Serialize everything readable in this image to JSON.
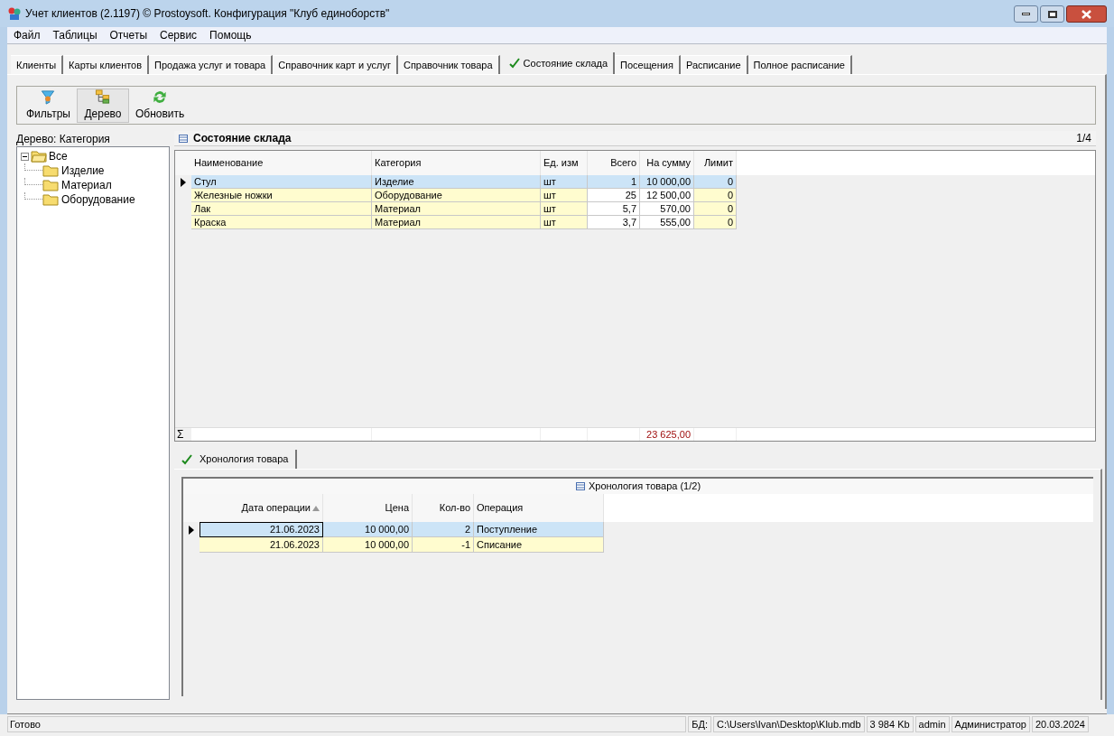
{
  "window": {
    "title": "Учет клиентов (2.1197) © Prostoysoft. Конфигурация \"Клуб единоборств\""
  },
  "menu": [
    "Файл",
    "Таблицы",
    "Отчеты",
    "Сервис",
    "Помощь"
  ],
  "tabs": [
    {
      "label": "Клиенты",
      "selected": false
    },
    {
      "label": "Карты клиентов",
      "selected": false
    },
    {
      "label": "Продажа услуг и товара",
      "selected": false
    },
    {
      "label": "Справочник карт и услуг",
      "selected": false
    },
    {
      "label": "Справочник товара",
      "selected": false
    },
    {
      "label": "Состояние склада",
      "selected": true
    },
    {
      "label": "Посещения",
      "selected": false
    },
    {
      "label": "Расписание",
      "selected": false
    },
    {
      "label": "Полное расписание",
      "selected": false
    }
  ],
  "toolbar": [
    {
      "kind": "filter",
      "label": "Фильтры",
      "selected": false
    },
    {
      "kind": "tree",
      "label": "Дерево",
      "selected": true
    },
    {
      "kind": "refresh",
      "label": "Обновить",
      "selected": false
    }
  ],
  "tree": {
    "title": "Дерево: Категория",
    "items": [
      {
        "label": "Все",
        "expanded": true,
        "children": [
          {
            "label": "Изделие"
          },
          {
            "label": "Материал"
          },
          {
            "label": "Оборудование"
          }
        ]
      }
    ]
  },
  "grid": {
    "title": "Состояние склада",
    "counter": "1/4",
    "total_symbol": "Σ",
    "columns": [
      {
        "label": "Наименование",
        "kind": "text"
      },
      {
        "label": "Категория",
        "kind": "text"
      },
      {
        "label": "Ед. изм",
        "kind": "text"
      },
      {
        "label": "Всего",
        "kind": "computed"
      },
      {
        "label": "На сумму",
        "kind": "computed",
        "total": "23 625,00"
      },
      {
        "label": "Лимит",
        "kind": "number"
      }
    ],
    "rows": [
      {
        "selected": true,
        "cells": [
          "Стул",
          "Изделие",
          "шт",
          "1",
          "10 000,00",
          "0"
        ]
      },
      {
        "selected": false,
        "cells": [
          "Железные ножки",
          "Оборудование",
          "шт",
          "25",
          "12 500,00",
          "0"
        ]
      },
      {
        "selected": false,
        "cells": [
          "Лак",
          "Материал",
          "шт",
          "5,7",
          "570,00",
          "0"
        ]
      },
      {
        "selected": false,
        "cells": [
          "Краска",
          "Материал",
          "шт",
          "3,7",
          "555,00",
          "0"
        ]
      }
    ]
  },
  "detail_tab": {
    "label": "Хронология товара",
    "selected": true
  },
  "detail": {
    "title": "Хронология товара (1/2)",
    "columns": [
      {
        "label": "Дата операции",
        "kind": "number",
        "sort_ascending": true
      },
      {
        "label": "Цена",
        "kind": "number"
      },
      {
        "label": "Кол-во",
        "kind": "number"
      },
      {
        "label": "Операция",
        "kind": "text"
      }
    ],
    "rows": [
      {
        "selected": true,
        "cells": [
          "21.06.2023",
          "10 000,00",
          "2",
          "Поступление"
        ]
      },
      {
        "selected": false,
        "cells": [
          "21.06.2023",
          "10 000,00",
          "-1",
          "Списание"
        ]
      }
    ]
  },
  "status_bar": {
    "message": "Готово",
    "db_label": "БД:",
    "fields": [
      "C:\\Users\\Ivan\\Desktop\\Klub.mdb",
      "3 984 Kb",
      "admin",
      "Администратор",
      "20.03.2024"
    ]
  }
}
